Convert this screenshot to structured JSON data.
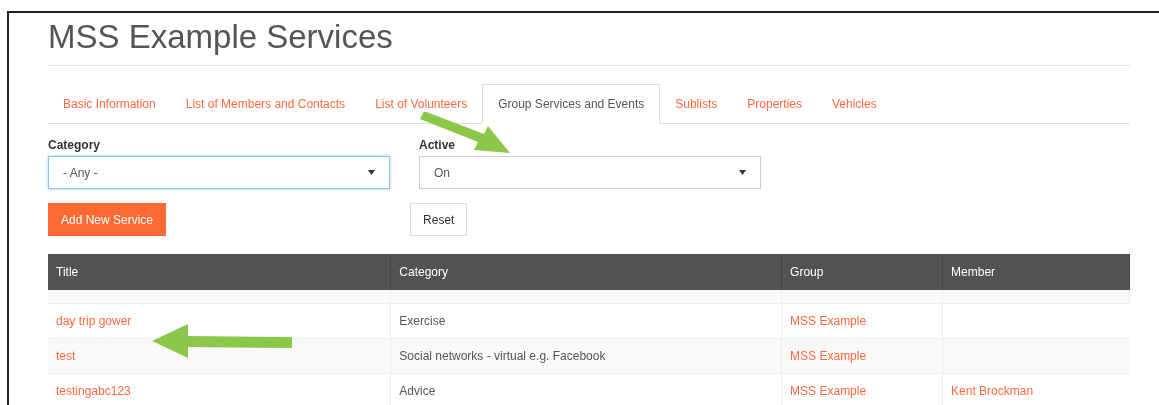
{
  "title": "MSS Example Services",
  "tabs": [
    {
      "label": "Basic Information",
      "selected": false
    },
    {
      "label": "List of Members and Contacts",
      "selected": false
    },
    {
      "label": "List of Volunteers",
      "selected": false
    },
    {
      "label": "Group Services and Events",
      "selected": true
    },
    {
      "label": "Sublists",
      "selected": false
    },
    {
      "label": "Properties",
      "selected": false
    },
    {
      "label": "Vehicles",
      "selected": false
    }
  ],
  "filters": [
    {
      "label": "Category",
      "value": "- Any -",
      "focused": true
    },
    {
      "label": "Active",
      "value": "On",
      "focused": false
    }
  ],
  "buttons": [
    {
      "label": "Add New Service",
      "kind": "primary"
    },
    {
      "label": "Reset",
      "kind": "default"
    }
  ],
  "table": {
    "columns": [
      "Title",
      "Category",
      "Group",
      "Member"
    ],
    "rows": [
      {
        "title": "day trip gower",
        "category": "Exercise",
        "group": "MSS Example"
      },
      {
        "title": "test",
        "category": "Social networks - virtual e.g. Facebook",
        "group": "MSS Example"
      },
      {
        "title": "testingabc123",
        "category": "Advice",
        "group": "MSS Example",
        "member": "Kent Brockman"
      }
    ]
  }
}
